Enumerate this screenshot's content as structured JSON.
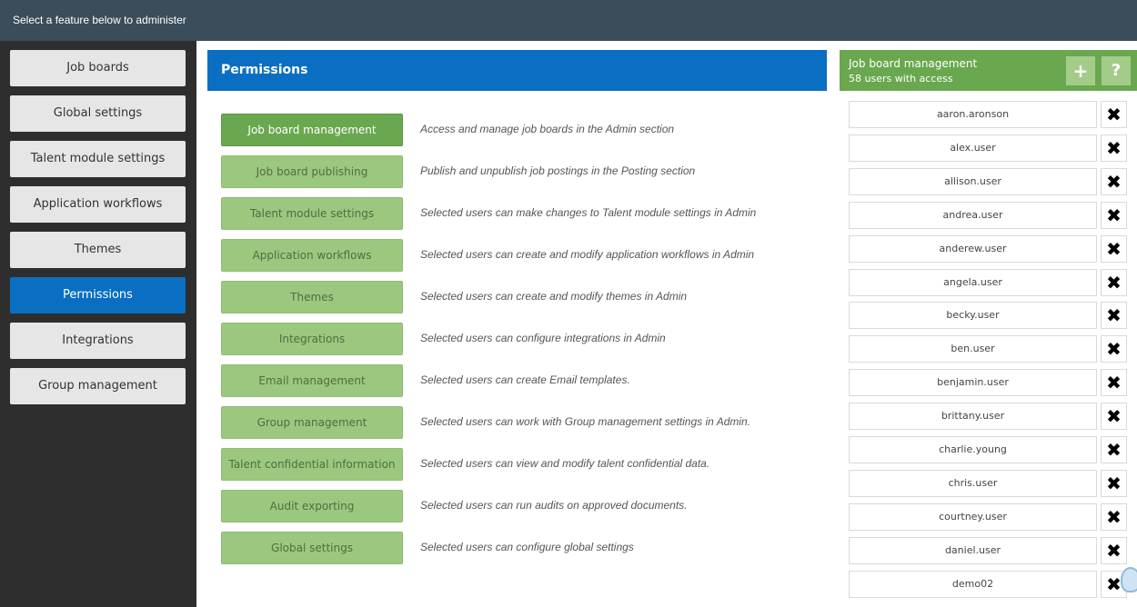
{
  "topbar": {
    "text": "Select a feature below to administer"
  },
  "sidebar": {
    "items": [
      {
        "label": "Job boards"
      },
      {
        "label": "Global settings"
      },
      {
        "label": "Talent module settings"
      },
      {
        "label": "Application workflows"
      },
      {
        "label": "Themes"
      },
      {
        "label": "Permissions",
        "active": true
      },
      {
        "label": "Integrations"
      },
      {
        "label": "Group management"
      }
    ]
  },
  "main": {
    "title": "Permissions",
    "permissions": [
      {
        "label": "Job board management",
        "description": "Access and manage job boards in the Admin section",
        "active": true
      },
      {
        "label": "Job board publishing",
        "description": "Publish and unpublish job postings in the Posting section"
      },
      {
        "label": "Talent module settings",
        "description": "Selected users can make changes to Talent module settings in Admin"
      },
      {
        "label": "Application workflows",
        "description": "Selected users can create and modify application workflows in Admin"
      },
      {
        "label": "Themes",
        "description": "Selected users can create and modify themes in Admin"
      },
      {
        "label": "Integrations",
        "description": "Selected users can configure integrations in Admin"
      },
      {
        "label": "Email management",
        "description": "Selected users can create Email templates."
      },
      {
        "label": "Group management",
        "description": "Selected users can work with Group management settings in Admin."
      },
      {
        "label": "Talent confidential information",
        "description": "Selected users can view and modify talent confidential data."
      },
      {
        "label": "Audit exporting",
        "description": "Selected users can run audits on approved documents."
      },
      {
        "label": "Global settings",
        "description": "Selected users can configure global settings"
      }
    ]
  },
  "right_panel": {
    "title": "Job board management",
    "subtitle": "58 users with access",
    "add_icon": "plus-icon",
    "add_symbol": "+",
    "help_icon": "question-icon",
    "help_symbol": "?",
    "remove_icon": "close-icon",
    "remove_symbol": "✖",
    "users": [
      "aaron.aronson",
      "alex.user",
      "allison.user",
      "andrea.user",
      "anderew.user",
      "angela.user",
      "becky.user",
      "ben.user",
      "benjamin.user",
      "brittany.user",
      "charlie.young",
      "chris.user",
      "courtney.user",
      "daniel.user",
      "demo02"
    ]
  },
  "colors": {
    "topbar": "#3b4c5a",
    "sidebar": "#2e2e2e",
    "accent_blue": "#0a6fc2",
    "green_active": "#6aa84f",
    "green_inactive": "#9cc77f"
  }
}
